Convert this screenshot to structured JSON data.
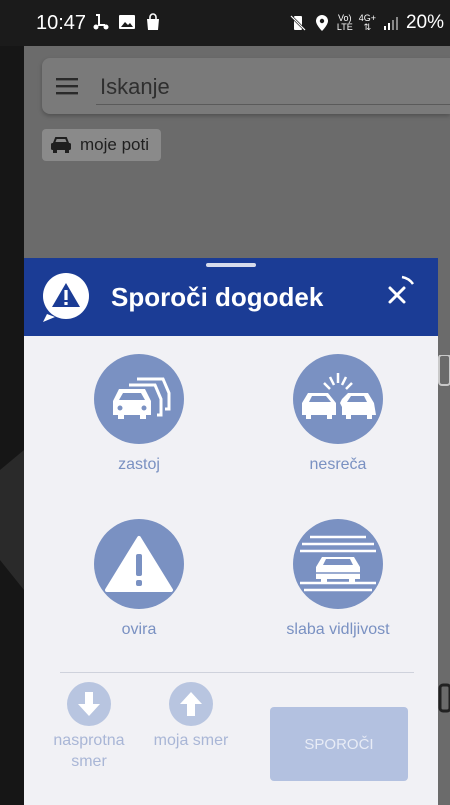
{
  "status_bar": {
    "time": "10:47",
    "lte_top": "Vo)",
    "lte_bottom": "LTE",
    "net_top": "4G+",
    "battery": "20%"
  },
  "search": {
    "placeholder": "Iskanje"
  },
  "routes_chip": {
    "label": "moje poti"
  },
  "sheet": {
    "title": "Sporoči dogodek",
    "events": [
      {
        "label": "zastoj",
        "icon": "traffic-jam-icon"
      },
      {
        "label": "nesreča",
        "icon": "car-crash-icon"
      },
      {
        "label": "ovira",
        "icon": "warning-triangle-icon"
      },
      {
        "label": "slaba vidljivost",
        "icon": "fog-car-icon"
      }
    ],
    "directions": [
      {
        "label_line1": "nasprotna",
        "label_line2": "smer",
        "icon": "arrow-down-icon"
      },
      {
        "label_line1": "moja smer",
        "icon": "arrow-up-icon"
      }
    ],
    "report_button": "SPOROČI"
  },
  "colors": {
    "header": "#1b3c95",
    "event_circle": "#7a91c2",
    "sheet_bg": "#f1f1f5",
    "disabled_button": "#b3c1e0"
  }
}
